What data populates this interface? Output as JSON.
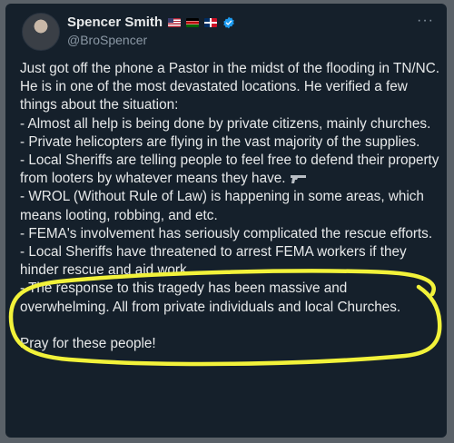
{
  "author": {
    "display_name": "Spencer Smith",
    "handle": "@BroSpencer",
    "flags": [
      "us-flag-icon",
      "kenya-flag-icon",
      "dominican-republic-flag-icon"
    ],
    "verified_icon": "verified-badge-icon"
  },
  "post": {
    "lines": [
      "Just got off the phone a Pastor in the midst of the flooding in TN/NC. He is in one of the most devastated locations. He verified a few things about the situation:",
      "- Almost all help is being done by private citizens, mainly churches.",
      "- Private helicopters are flying in the vast majority of the supplies.",
      "- Local Sheriffs are telling people to feel free to defend their property from looters by whatever means they have.",
      "- WROL (Without Rule of Law) is happening in some areas, which means looting, robbing, and etc.",
      "- FEMA's involvement has seriously complicated the rescue efforts.",
      "- Local Sheriffs have threatened to arrest FEMA workers if they hinder rescue and aid work.",
      "- The response to this tragedy has been massive and overwhelming. All from private individuals and local Churches.",
      "Pray for these people!"
    ],
    "emoji_after_line_4": "pistol-icon"
  },
  "colors": {
    "background": "#15202b",
    "text": "#e7e9ea",
    "secondary_text": "#8b98a5",
    "verified_badge": "#1d9bf0",
    "highlighter": "#f2f23a"
  }
}
